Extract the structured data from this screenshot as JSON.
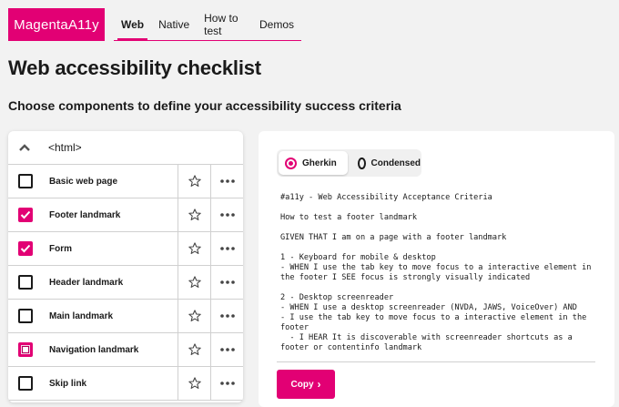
{
  "header": {
    "logo": "MagentaA11y",
    "nav": [
      {
        "label": "Web",
        "active": true
      },
      {
        "label": "Native",
        "active": false
      },
      {
        "label": "How to test",
        "active": false
      },
      {
        "label": "Demos",
        "active": false
      }
    ]
  },
  "page": {
    "title": "Web accessibility checklist",
    "subtitle": "Choose components to define your accessibility success criteria"
  },
  "list": {
    "header": "<html>",
    "items": [
      {
        "label": "Basic web page",
        "state": "unchecked"
      },
      {
        "label": "Footer landmark",
        "state": "checked"
      },
      {
        "label": "Form",
        "state": "checked"
      },
      {
        "label": "Header landmark",
        "state": "unchecked"
      },
      {
        "label": "Main landmark",
        "state": "unchecked"
      },
      {
        "label": "Navigation landmark",
        "state": "partial"
      },
      {
        "label": "Skip link",
        "state": "unchecked"
      }
    ]
  },
  "output": {
    "toggle": {
      "option1": "Gherkin",
      "option2": "Condensed",
      "selected": "Gherkin"
    },
    "criteria_text": "#a11y - Web Accessibility Acceptance Criteria\n\nHow to test a footer landmark\n\nGIVEN THAT I am on a page with a footer landmark\n\n1 - Keyboard for mobile & desktop\n- WHEN I use the tab key to move focus to a interactive element in the footer I SEE focus is strongly visually indicated\n\n2 - Desktop screenreader\n- WHEN I use a desktop screenreader (NVDA, JAWS, VoiceOver) AND\n- I use the tab key to move focus to a interactive element in the footer\n  - I HEAR It is discoverable with screenreader shortcuts as a footer or contentinfo landmark",
    "copy_label": "Copy"
  },
  "colors": {
    "accent": "#e20074",
    "background": "#f2f2f2"
  }
}
